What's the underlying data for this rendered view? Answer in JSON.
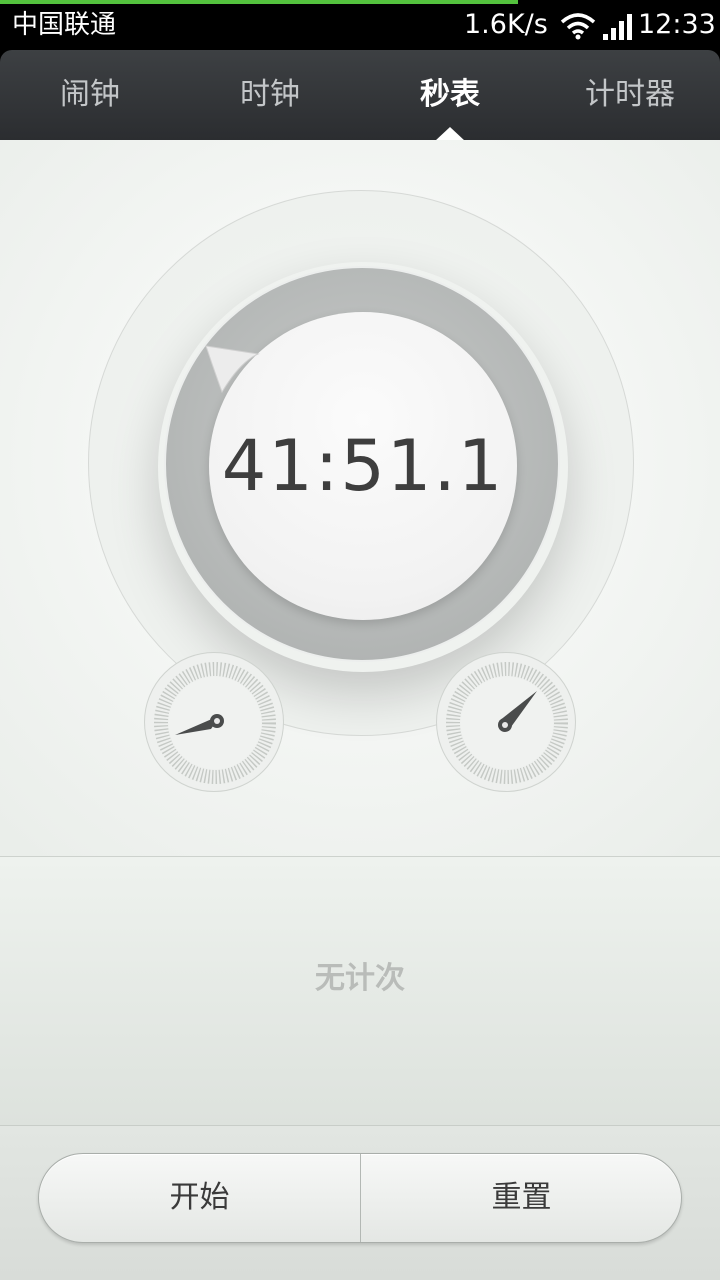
{
  "status_bar": {
    "carrier": "中国联通",
    "net_speed": "1.6K/s",
    "time": "12:33",
    "icons": [
      "wifi-icon",
      "signal-icon"
    ],
    "download_progress": 0.72
  },
  "tabs": [
    {
      "label": "闹钟",
      "active": false
    },
    {
      "label": "时钟",
      "active": false
    },
    {
      "label": "秒表",
      "active": true
    },
    {
      "label": "计时器",
      "active": false
    }
  ],
  "stopwatch": {
    "elapsed": "41:51.1"
  },
  "laps": {
    "empty_text": "无计次"
  },
  "buttons": {
    "start": "开始",
    "reset": "重置"
  },
  "colors": {
    "accent_progress": "#54c23e",
    "tab_bar": "#2b2d30"
  }
}
